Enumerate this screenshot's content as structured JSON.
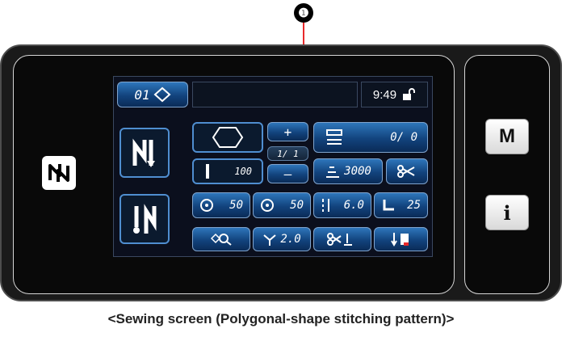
{
  "callout": {
    "number": "❶",
    "color": "#e8292b"
  },
  "side": {
    "m_label": "M",
    "info_label": "i"
  },
  "lcd": {
    "pattern_no": "01",
    "time": "9:49",
    "plus": "+",
    "minus": "–",
    "step": "1/ 1",
    "counter": "0/  0",
    "stitch_count": "100",
    "speed": "3000",
    "thread_left": "50",
    "thread_right": "50",
    "pitch": "6.0",
    "presser": "25",
    "stitch_width": "2.0"
  },
  "caption": "<Sewing screen (Polygonal-shape stitching pattern)>",
  "colors": {
    "lcd_bg": "#0b0f1d",
    "button_blue": "#12437d",
    "callout_red": "#e8292b"
  }
}
